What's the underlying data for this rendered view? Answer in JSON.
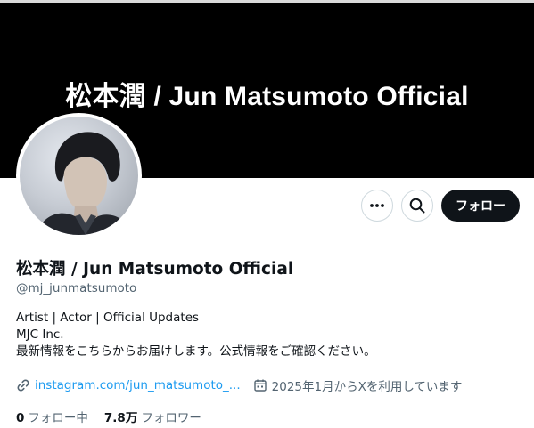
{
  "banner": {
    "text": "松本潤 / Jun Matsumoto Official"
  },
  "actions": {
    "more_icon": "more-horizontal",
    "search_icon": "search",
    "follow_label": "フォロー"
  },
  "profile": {
    "display_name": "松本潤 / Jun Matsumoto Official",
    "handle": "@mj_junmatsumoto",
    "bio_lines": [
      "Artist | Actor | Official Updates",
      "MJC Inc.",
      "最新情報をこちらからお届けします。公式情報をご確認ください。"
    ],
    "link_text": "instagram.com/jun_matsumoto_...",
    "joined_text": "2025年1月からXを利用しています"
  },
  "stats": {
    "following_count": "0",
    "following_label": "フォロー中",
    "followers_count": "7.8万",
    "followers_label": "フォロワー"
  },
  "colors": {
    "link": "#1d9bf0",
    "secondary_text": "#536471",
    "primary_text": "#0f1419",
    "banner": "#000000"
  }
}
